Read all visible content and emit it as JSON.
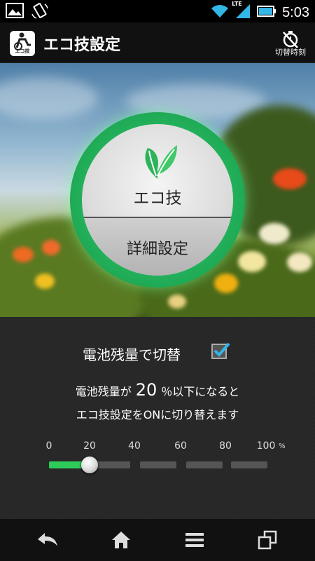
{
  "status_bar": {
    "time": "5:03",
    "network_label": "LTE",
    "icons": [
      "image-notification-icon",
      "screen-rotate-icon",
      "wifi-icon",
      "signal-icon",
      "battery-icon"
    ]
  },
  "action_bar": {
    "app_logo_text": "エコ技",
    "title": "エコ技設定",
    "switch_time_label": "切替時刻"
  },
  "eco_circle": {
    "main_label": "エコ技",
    "detail_label": "詳細設定"
  },
  "battery_switch": {
    "label": "電池残量で切替",
    "checked": true,
    "desc_prefix": "電池残量が",
    "threshold": "20",
    "desc_suffix": "％以下になると",
    "desc_line2": "エコ技設定をONに切り替えます"
  },
  "slider": {
    "ticks": [
      "0",
      "20",
      "40",
      "60",
      "80",
      "100"
    ],
    "unit": "%",
    "value": 20,
    "min": 0,
    "max": 100
  },
  "nav_bar": {
    "icons": [
      "back-icon",
      "home-icon",
      "menu-icon",
      "recent-apps-icon"
    ]
  },
  "colors": {
    "accent_green": "#2ecc5a",
    "ring_green": "#1faa55"
  }
}
